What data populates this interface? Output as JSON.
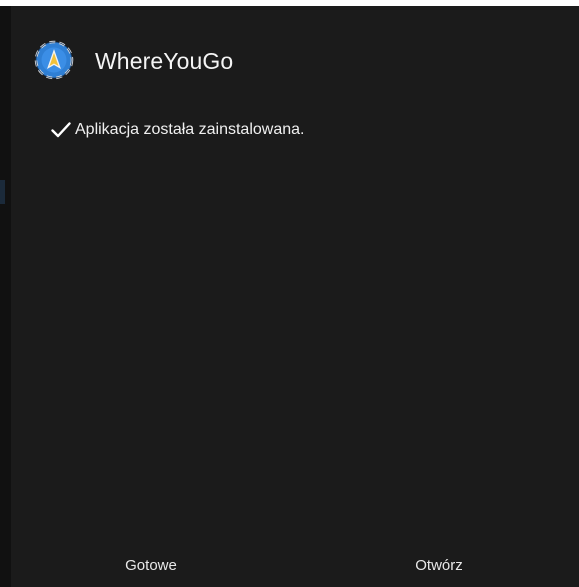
{
  "dialog": {
    "app_name": "WhereYouGo",
    "app_icon": "compass-globe-icon",
    "status_icon": "check-icon",
    "status_message": "Aplikacja została zainstalowana.",
    "buttons": {
      "done_label": "Gotowe",
      "open_label": "Otwórz"
    }
  },
  "colors": {
    "dialog_background": "#1b1b1b",
    "text": "#f0f0f0",
    "icon_blue": "#2f7fd4"
  }
}
